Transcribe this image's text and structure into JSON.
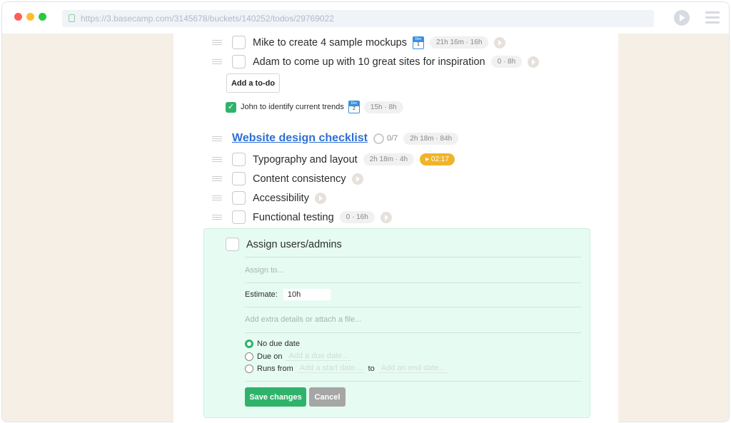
{
  "browser": {
    "url": "https://3.basecamp.com/3145678/buckets/140252/todos/29769022",
    "dots": [
      "#fe5f57",
      "#febc2e",
      "#28c840"
    ]
  },
  "todos": [
    {
      "label": "Mike to create 4 sample mockups",
      "cal_month": "Dec",
      "cal_day": "1",
      "time": "21h 16m · 16h"
    },
    {
      "label": "Adam to come up with 10 great sites for inspiration",
      "time": "0 · 8h"
    }
  ],
  "add_todo": "Add a to-do",
  "completed": {
    "label": "John to identify current trends",
    "cal_month": "Dec",
    "cal_day": "2",
    "time": "15h · 8h",
    "checked": true
  },
  "checklist": {
    "title": "Website design checklist",
    "progress": "0/7",
    "time": "2h 18m · 84h",
    "items": [
      {
        "label": "Typography and layout",
        "time": "2h 18m · 4h",
        "timer": "02:17"
      },
      {
        "label": "Content consistency"
      },
      {
        "label": "Accessibility"
      },
      {
        "label": "Functional testing",
        "time": "0 · 16h"
      }
    ]
  },
  "editor": {
    "title": "Assign users/admins",
    "assign_placeholder": "Assign to...",
    "estimate_label": "Estimate:",
    "estimate_value": "10h",
    "details_placeholder": "Add extra details or attach a file...",
    "no_due": "No due date",
    "due_on": "Due on",
    "due_placeholder": "Add a due date...",
    "runs_from": "Runs from",
    "start_placeholder": "Add a start date...",
    "to": "to",
    "end_placeholder": "Add an end date...",
    "selected": "No due date",
    "save": "Save changes",
    "cancel": "Cancel"
  },
  "colors": {
    "accent": "#2fb36b",
    "link": "#2e6fd6",
    "timer": "#f0b429",
    "page_bg": "#f6efe6"
  }
}
